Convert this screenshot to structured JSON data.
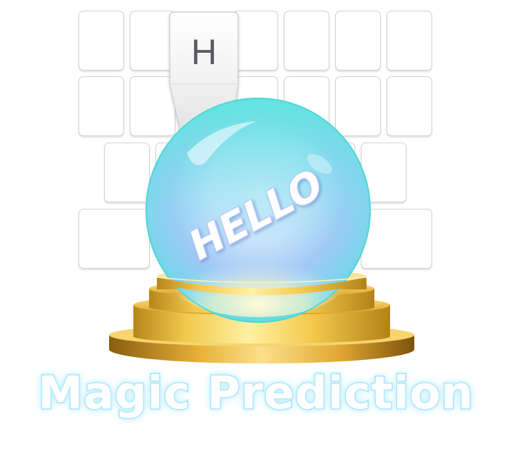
{
  "popup_key_letter": "H",
  "crystal_ball_text": "HELLO",
  "title": "Magic Prediction",
  "colors": {
    "key_border": "#d2d2d4",
    "key_fill": "#ffffff",
    "orb_cyan": "#5ee3df",
    "orb_blue": "#8fb5f3",
    "gold": "#e7b935",
    "title_glow": "#8fdcf6"
  }
}
